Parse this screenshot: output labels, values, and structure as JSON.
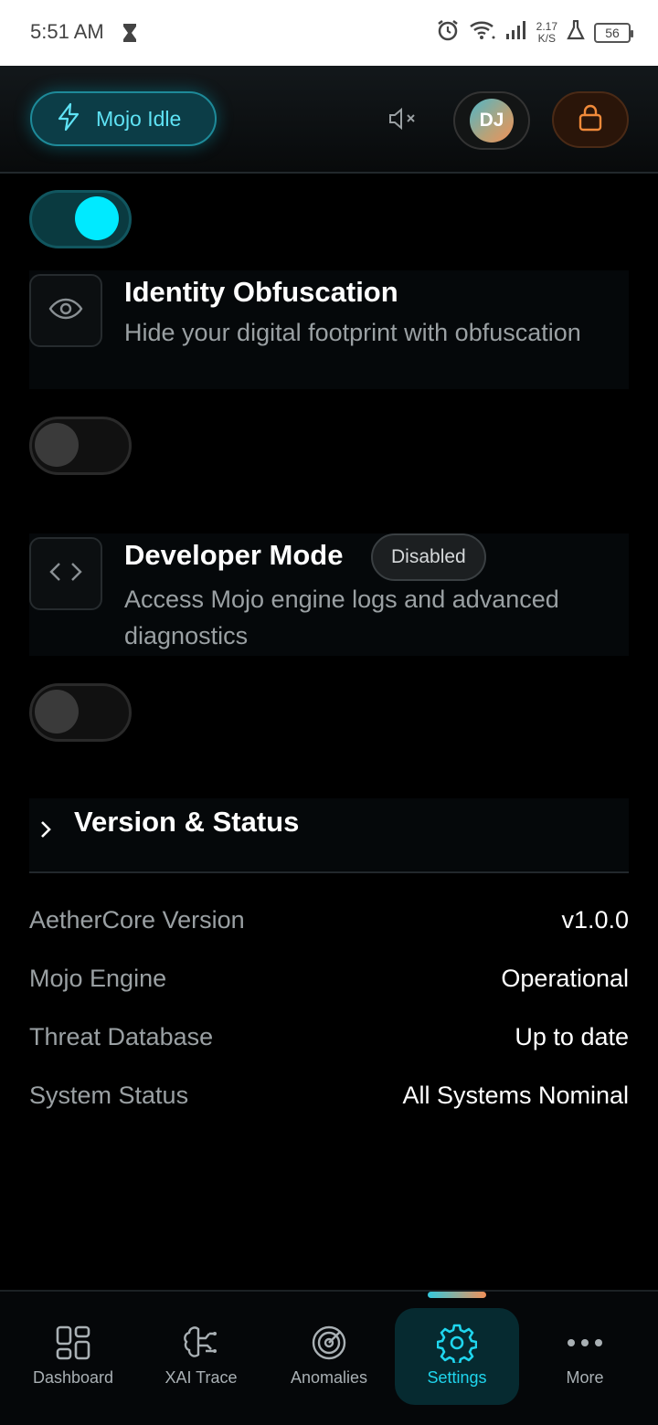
{
  "status_bar": {
    "time": "5:51 AM",
    "net_speed_value": "2.17",
    "net_speed_unit": "K/S",
    "battery": "56"
  },
  "header": {
    "mojo_status": "Mojo Idle",
    "avatar_initials": "DJ"
  },
  "settings": {
    "identity": {
      "title": "Identity Obfuscation",
      "description": "Hide your digital footprint with obfuscation",
      "enabled": false
    },
    "developer": {
      "title": "Developer Mode",
      "badge": "Disabled",
      "description": "Access Mojo engine logs and advanced diagnostics",
      "enabled": false
    },
    "previous_toggle_enabled": true
  },
  "version_status": {
    "title": "Version & Status",
    "rows": [
      {
        "label": "AetherCore Version",
        "value": "v1.0.0"
      },
      {
        "label": "Mojo Engine",
        "value": "Operational"
      },
      {
        "label": "Threat Database",
        "value": "Up to date"
      },
      {
        "label": "System Status",
        "value": "All Systems Nominal"
      }
    ]
  },
  "nav": {
    "items": [
      {
        "label": "Dashboard",
        "icon": "dashboard-grid-icon"
      },
      {
        "label": "XAI Trace",
        "icon": "brain-icon"
      },
      {
        "label": "Anomalies",
        "icon": "radar-icon"
      },
      {
        "label": "Settings",
        "icon": "gear-icon",
        "active": true
      },
      {
        "label": "More",
        "icon": "more-dots-icon"
      }
    ]
  },
  "colors": {
    "accent": "#00eaff",
    "lock_accent": "#f08a3a",
    "background": "#000000"
  }
}
